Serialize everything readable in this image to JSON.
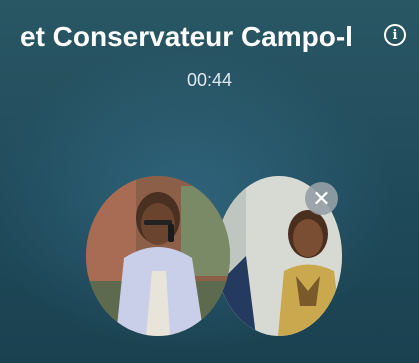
{
  "call": {
    "title": "et Conservateur Campo-l",
    "timer": "00:44"
  },
  "icons": {
    "info": "info-icon",
    "remove": "close-icon"
  },
  "colors": {
    "background": "#24505f",
    "text": "#ffffff",
    "remove_button": "#969fa5"
  }
}
